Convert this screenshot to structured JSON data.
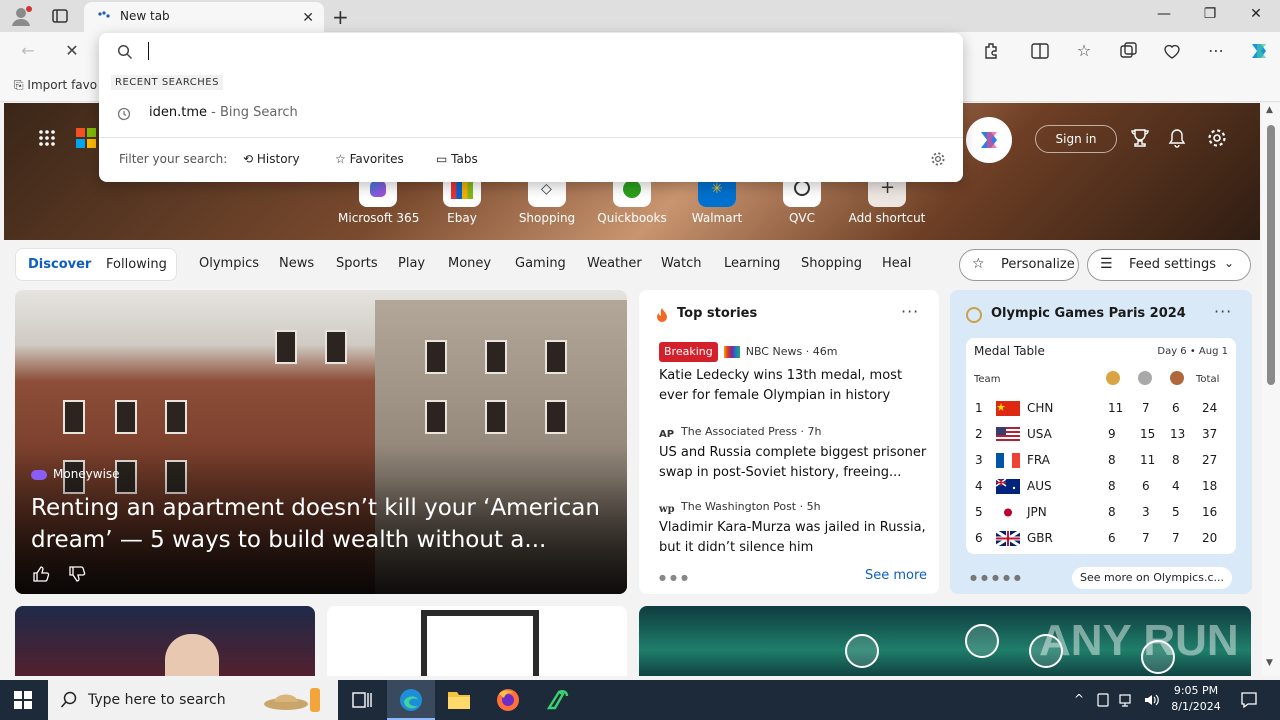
{
  "browser": {
    "tab_title": "New tab",
    "favbar_item": "Import favo"
  },
  "omnibox": {
    "query": "",
    "recent_label": "RECENT SEARCHES",
    "recent_item": "iden.tme",
    "recent_item_suffix": " - Bing Search",
    "filter_label": "Filter your search:",
    "filters": [
      "History",
      "Favorites",
      "Tabs"
    ]
  },
  "header": {
    "signin_label": "Sign in"
  },
  "shortcuts": [
    {
      "label": "Microsoft 365"
    },
    {
      "label": "Ebay"
    },
    {
      "label": "Shopping"
    },
    {
      "label": "Quickbooks"
    },
    {
      "label": "Walmart"
    },
    {
      "label": "QVC"
    },
    {
      "label": "Add shortcut"
    }
  ],
  "feed_nav": {
    "discover": "Discover",
    "following": "Following",
    "links": [
      "Olympics",
      "News",
      "Sports",
      "Play",
      "Money",
      "Gaming",
      "Weather",
      "Watch",
      "Learning",
      "Shopping",
      "Heal"
    ],
    "personalize": "Personalize",
    "feed_settings": "Feed settings"
  },
  "hero_article": {
    "source": "Moneywise",
    "title": "Renting an apartment doesn’t kill your ‘American dream’ — 5 ways to build wealth without a..."
  },
  "top_stories": {
    "heading": "Top stories",
    "see_more": "See more",
    "items": [
      {
        "badge": "Breaking",
        "source": "NBC News · 46m",
        "headline": "Katie Ledecky wins 13th medal, most ever for female Olympian in history"
      },
      {
        "source_logo": "AP",
        "source": "The Associated Press · 7h",
        "headline": "US and Russia complete biggest prisoner swap in post-Soviet history, freeing..."
      },
      {
        "source_logo": "wp",
        "source": "The Washington Post · 5h",
        "headline": "Vladimir Kara-Murza was jailed in Russia, but it didn’t silence him"
      }
    ]
  },
  "olympics": {
    "heading": "Olympic Games Paris 2024",
    "table_title": "Medal Table",
    "day": "Day 6 • Aug 1",
    "team_header": "Team",
    "total_header": "Total",
    "see_more": "See more on Olympics.c...",
    "rows": [
      {
        "rank": "1",
        "team": "CHN",
        "gold": "11",
        "silver": "7",
        "bronze": "6",
        "total": "24"
      },
      {
        "rank": "2",
        "team": "USA",
        "gold": "9",
        "silver": "15",
        "bronze": "13",
        "total": "37"
      },
      {
        "rank": "3",
        "team": "FRA",
        "gold": "8",
        "silver": "11",
        "bronze": "8",
        "total": "27"
      },
      {
        "rank": "4",
        "team": "AUS",
        "gold": "8",
        "silver": "6",
        "bronze": "4",
        "total": "18"
      },
      {
        "rank": "5",
        "team": "JPN",
        "gold": "8",
        "silver": "3",
        "bronze": "5",
        "total": "16"
      },
      {
        "rank": "6",
        "team": "GBR",
        "gold": "6",
        "silver": "7",
        "bronze": "7",
        "total": "20"
      }
    ]
  },
  "watermark": "ANY RUN",
  "taskbar": {
    "search_placeholder": "Type here to search",
    "time": "9:05 PM",
    "date": "8/1/2024"
  },
  "colors": {
    "accent": "#0f5fbf",
    "breaking": "#d4202a",
    "taskbar": "#1d2a3a"
  }
}
